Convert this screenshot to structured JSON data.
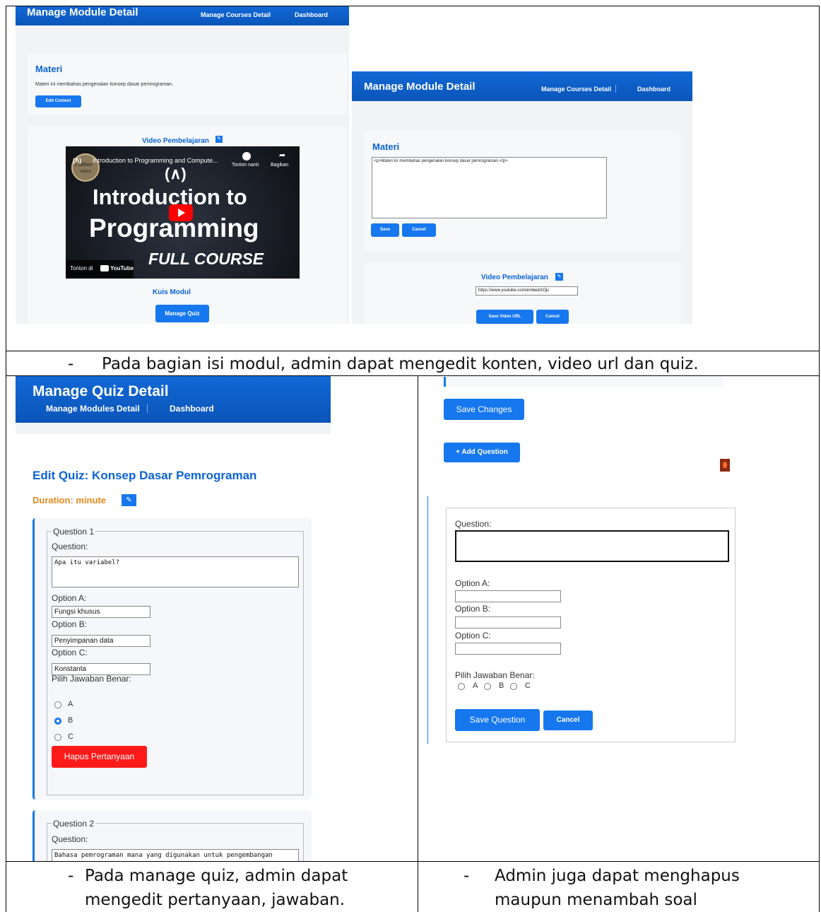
{
  "captions": {
    "row1": "Pada bagian isi modul, admin dapat mengedit konten, video url dan quiz.",
    "row2_left_line1": "Pada manage quiz, admin dapat",
    "row2_left_line2": "mengedit pertanyaan, jawaban.",
    "row2_right_line1": "Admin juga dapat menghapus",
    "row2_right_line2": "maupun menambah soal",
    "bullet": "-"
  },
  "shot1": {
    "header_title": "Manage Module Detail",
    "nav_courses": "Manage Courses Detail",
    "nav_dashboard": "Dashboard",
    "materi_title": "Materi",
    "materi_text": "Materi ini membahas pengenalan konsep dasar pemrograman.",
    "edit_content": "Edit Content",
    "video_title": "Video Pembelajaran",
    "video": {
      "channel_title": "Introduction to Programming and Compute...",
      "badge_line1": "1 Million",
      "badge_line2": "VIEWS",
      "watch_later": "Tonton nanti",
      "share": "Bagikan",
      "big1": "Introduction to",
      "big2": "Programming",
      "big3": "FULL COURSE",
      "watch_on": "Tonton di",
      "youtube": "YouTube"
    },
    "quiz_title": "Kuis Modul",
    "manage_quiz": "Manage Quiz"
  },
  "shot2": {
    "header_title": "Manage Module Detail",
    "nav_courses": "Manage Courses Detail",
    "nav_dashboard": "Dashboard",
    "materi_title": "Materi",
    "textarea_value": "<p>Materi ini membahas pengenalan konsep dasar pemrograman.</p>",
    "save": "Save",
    "cancel": "Cancel",
    "video_title": "Video Pembelajaran",
    "url_value": "https://www.youtube.com/embed/zOjc",
    "save_video_url": "Save Video URL",
    "cancel2": "Cancel"
  },
  "shot3": {
    "header_title": "Manage Quiz Detail",
    "nav_modules": "Manage Modules Detail",
    "nav_dashboard": "Dashboard",
    "edit_quiz_title": "Edit Quiz: Konsep Dasar Pemrograman",
    "duration": "Duration: minute",
    "q1": {
      "legend": "Question 1",
      "question_label": "Question:",
      "question_value": "Apa itu variabel?",
      "option_a_label": "Option A:",
      "option_a_value": "Fungsi khusus",
      "option_b_label": "Option B:",
      "option_b_value": "Penyimpanan data",
      "option_c_label": "Option C:",
      "option_c_value": "Konstanta",
      "correct_label": "Pilih Jawaban Benar:",
      "radio_a": "A",
      "radio_b": "B",
      "radio_c": "C",
      "delete": "Hapus Pertanyaan"
    },
    "q2": {
      "legend": "Question 2",
      "question_label": "Question:",
      "question_value": "Bahasa pemrograman mana yang digunakan untuk pengembangan"
    }
  },
  "shot4": {
    "save_changes": "Save Changes",
    "add_question": "+ Add Question",
    "question_label": "Question:",
    "option_a_label": "Option A:",
    "option_b_label": "Option B:",
    "option_c_label": "Option C:",
    "correct_label": "Pilih Jawaban Benar:",
    "radio_a": "A",
    "radio_b": "B",
    "radio_c": "C",
    "save_question": "Save Question",
    "cancel": "Cancel"
  },
  "colors": {
    "primary": "#1677ee",
    "header": "#0a5fc8",
    "danger": "#ff1a1a",
    "duration": "#e58a1f"
  }
}
